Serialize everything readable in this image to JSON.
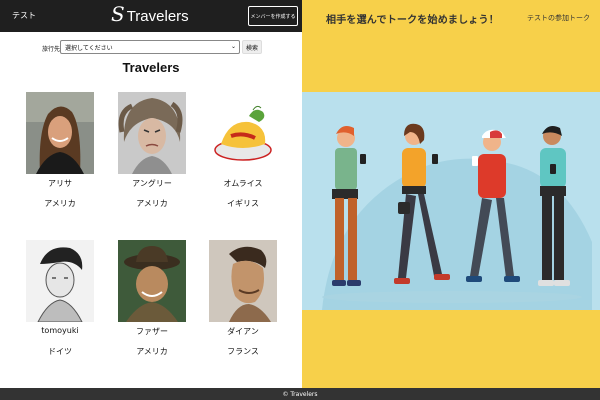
{
  "header": {
    "user_name": "テスト",
    "logo_mark": "S",
    "app_title": "Travelers",
    "create_member_label": "メンバーを作成する"
  },
  "filter": {
    "label": "旅行先",
    "selected": "選択してください",
    "search_label": "検索"
  },
  "section_title": "Travelers",
  "members": [
    {
      "name": "アリサ",
      "country": "アメリカ",
      "photo": "woman-smiling"
    },
    {
      "name": "アングリー",
      "country": "アメリカ",
      "photo": "angry-woman"
    },
    {
      "name": "オムライス",
      "country": "イギリス",
      "photo": "omelette-rice"
    },
    {
      "name": "tomoyuki",
      "country": "ドイツ",
      "photo": "man-sketch"
    },
    {
      "name": "ファザー",
      "country": "アメリカ",
      "photo": "old-man-hat"
    },
    {
      "name": "ダイアン",
      "country": "フランス",
      "photo": "man-profile"
    }
  ],
  "right_panel": {
    "invite_text": "相手を選んでトークを始めましょう！",
    "talk_title": "テストの参加トーク",
    "illustration": "people-with-phones"
  },
  "footer": {
    "copyright": "© Travelers"
  },
  "colors": {
    "header_bg": "#1f1f1f",
    "right_panel_bg": "#f7d04a",
    "illustration_bg": "#b9e0ed",
    "footer_bg": "#333333"
  }
}
